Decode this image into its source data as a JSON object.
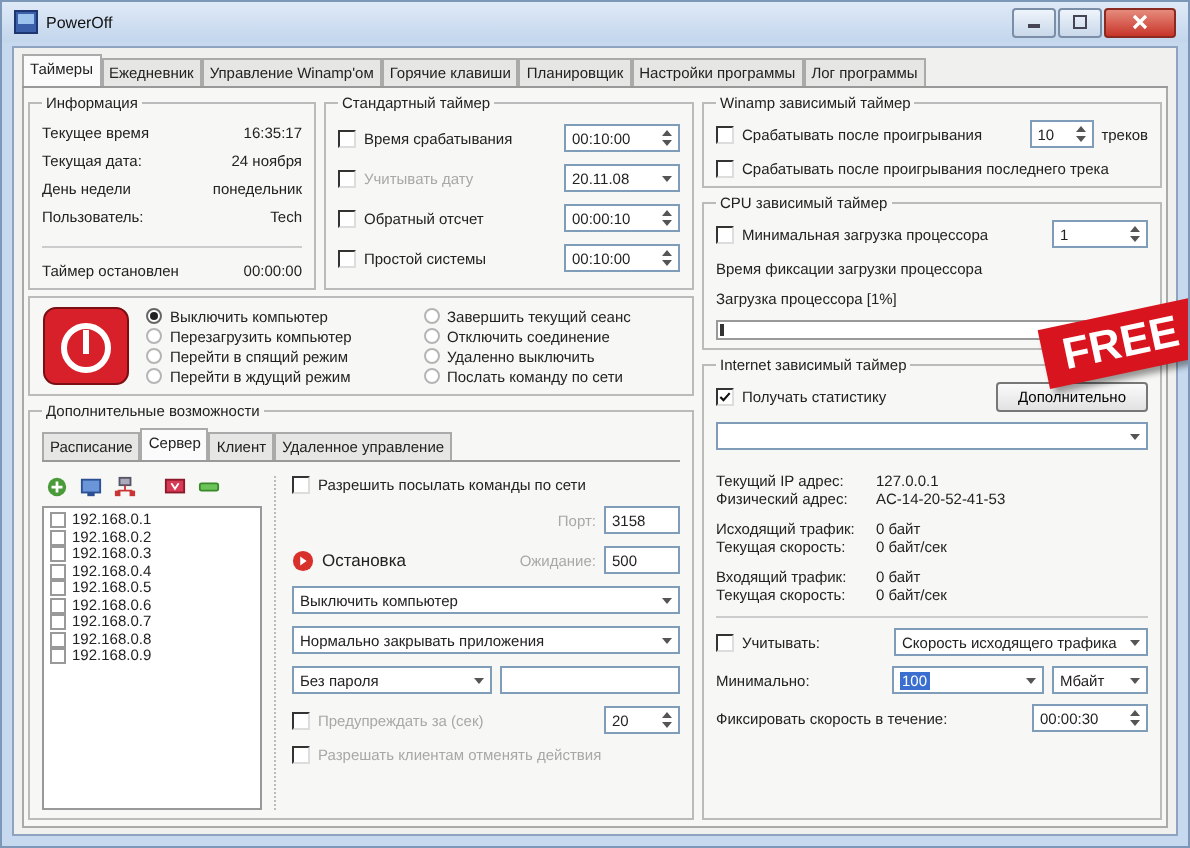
{
  "window": {
    "title": "PowerOff"
  },
  "tabs": [
    {
      "label": "Таймеры",
      "selected": true
    },
    {
      "label": "Ежедневник",
      "selected": false
    },
    {
      "label": "Управление Winamp'ом",
      "selected": false
    },
    {
      "label": "Горячие клавиши",
      "selected": false
    },
    {
      "label": "Планировщик",
      "selected": false
    },
    {
      "label": "Настройки программы",
      "selected": false
    },
    {
      "label": "Лог программы",
      "selected": false
    }
  ],
  "info": {
    "title": "Информация",
    "rows": [
      {
        "label": "Текущее время",
        "value": "16:35:17"
      },
      {
        "label": "Текущая дата:",
        "value": "24 ноября"
      },
      {
        "label": "День недели",
        "value": "понедельник"
      },
      {
        "label": "Пользователь:",
        "value": "Tech"
      }
    ],
    "timer_label": "Таймер остановлен",
    "timer_value": "00:00:00"
  },
  "standard_timer": {
    "title": "Стандартный таймер",
    "rows": [
      {
        "label": "Время срабатывания",
        "checked": false,
        "disabled": false,
        "value": "00:10:00",
        "kind": "spin"
      },
      {
        "label": "Учитывать дату",
        "checked": false,
        "disabled": true,
        "value": "20.11.08",
        "kind": "dropdown"
      },
      {
        "label": "Обратный отсчет",
        "checked": false,
        "disabled": false,
        "value": "00:00:10",
        "kind": "spin"
      },
      {
        "label": "Простой системы",
        "checked": false,
        "disabled": false,
        "value": "00:10:00",
        "kind": "spin"
      }
    ]
  },
  "actions": [
    {
      "label": "Выключить компьютер",
      "selected": true
    },
    {
      "label": "Перезагрузить компьютер",
      "selected": false
    },
    {
      "label": "Перейти в спящий режим",
      "selected": false
    },
    {
      "label": "Перейти в ждущий режим",
      "selected": false
    },
    {
      "label": "Завершить текущий сеанс",
      "selected": false
    },
    {
      "label": "Отключить соединение",
      "selected": false
    },
    {
      "label": "Удаленно выключить",
      "selected": false
    },
    {
      "label": "Послать команду по сети",
      "selected": false
    }
  ],
  "extra": {
    "title": "Дополнительные возможности",
    "tabs": [
      {
        "label": "Расписание",
        "selected": false
      },
      {
        "label": "Сервер",
        "selected": true
      },
      {
        "label": "Клиент",
        "selected": false
      },
      {
        "label": "Удаленное управление",
        "selected": false
      }
    ],
    "hosts": [
      {
        "label": "192.168.0.1",
        "checked": false
      },
      {
        "label": "192.168.0.2",
        "checked": false
      },
      {
        "label": "192.168.0.3",
        "checked": false
      },
      {
        "label": "192.168.0.4",
        "checked": false
      },
      {
        "label": "192.168.0.5",
        "checked": false
      },
      {
        "label": "192.168.0.6",
        "checked": false
      },
      {
        "label": "192.168.0.7",
        "checked": false
      },
      {
        "label": "192.168.0.8",
        "checked": false
      },
      {
        "label": "192.168.0.9",
        "checked": false
      }
    ],
    "allow": {
      "label": "Разрешить посылать команды по сети",
      "checked": false
    },
    "port": {
      "label": "Порт:",
      "value": "3158",
      "disabled": true
    },
    "status": "Остановка",
    "wait": {
      "label": "Ожидание:",
      "value": "500",
      "disabled": true
    },
    "action_select": "Выключить компьютер",
    "close_select": "Нормально закрывать приложения",
    "password_select": "Без пароля",
    "warn": {
      "label": "Предупреждать за (сек)",
      "checked": false,
      "disabled": true,
      "value": "20"
    },
    "allow_cancel": {
      "label": "Разрешать клиентам отменять действия",
      "checked": false,
      "disabled": true
    }
  },
  "winamp": {
    "title": "Winamp зависимый таймер",
    "play": {
      "label": "Срабатывать после проигрывания",
      "checked": false,
      "value": "10",
      "unit": "треков"
    },
    "last": {
      "label": "Срабатывать после проигрывания последнего трека",
      "checked": false
    }
  },
  "cpu": {
    "title": "CPU зависимый таймер",
    "min": {
      "label": "Минимальная загрузка процессора",
      "checked": false,
      "value": "1"
    },
    "fix_label": "Время фиксации загрузки процессора",
    "load_label": "Загрузка процессора [1%]",
    "level": 0.01
  },
  "internet": {
    "title": "Internet зависимый таймер",
    "stats": {
      "label": "Получать статистику",
      "checked": true
    },
    "more_button": "Дополнительно",
    "stat_groups": [
      [
        {
          "label": "Текущий IP адрес:",
          "value": "127.0.0.1"
        },
        {
          "label": "Физический адрес:",
          "value": "AC-14-20-52-41-53"
        }
      ],
      [
        {
          "label": "Исходящий трафик:",
          "value": "0 байт"
        },
        {
          "label": "Текущая скорость:",
          "value": "0 байт/сек"
        }
      ],
      [
        {
          "label": "Входящий трафик:",
          "value": "0 байт"
        },
        {
          "label": "Текущая скорость:",
          "value": "0 байт/сек"
        }
      ]
    ],
    "consider": {
      "label": "Учитывать:",
      "checked": false,
      "value": "Скорость исходящего трафика"
    },
    "minimum": {
      "label": "Минимально:",
      "value": "100",
      "text_selected": true,
      "unit": "Мбайт"
    },
    "fix": {
      "label": "Фиксировать скорость в течение:",
      "value": "00:00:30"
    }
  },
  "badge": "FREE"
}
